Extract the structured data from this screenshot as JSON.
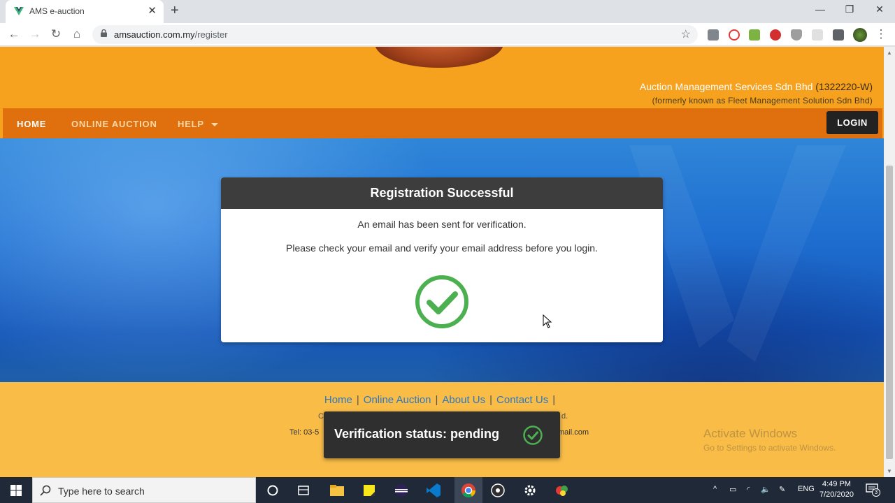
{
  "browser": {
    "tab_title": "AMS e-auction",
    "tab_close": "✕",
    "new_tab": "+",
    "url_host": "amsauction.com.my",
    "url_path": "/register",
    "window_controls": [
      "—",
      "❐",
      "✕"
    ]
  },
  "site": {
    "company_name": "Auction Management Services Sdn Bhd",
    "company_reg": "(1322220-W)",
    "formerly": "(formerly known as Fleet Management Solution Sdn Bhd)",
    "nav": [
      "HOME",
      "ONLINE AUCTION",
      "HELP"
    ],
    "login_label": "LOGIN"
  },
  "dialog": {
    "title": "Registration Successful",
    "line1": "An email has been sent for verification.",
    "line2": "Please check your email and verify your email address before you login.",
    "check_color": "#4caf50"
  },
  "footer": {
    "links": [
      "Home",
      "Online Auction",
      "About Us",
      "Contact Us"
    ],
    "separator": "|",
    "copyright_start": "C",
    "copyright_end": "d.",
    "tel": "Tel: 03-5",
    "email_end": "mail.com"
  },
  "watermark": {
    "line1": "Activate Windows",
    "line2": "Go to Settings to activate Windows."
  },
  "toast": {
    "text": "Verification status: pending"
  },
  "taskbar": {
    "search_placeholder": "Type here to search",
    "language": "ENG",
    "time": "4:49 PM",
    "date": "7/20/2020",
    "notification_count": "3"
  },
  "colors": {
    "header_orange": "#f6a21f",
    "nav_orange": "#e0700e",
    "footer_yellow": "#f8bc47",
    "link_blue": "#2b78c4",
    "success_green": "#4caf50"
  }
}
